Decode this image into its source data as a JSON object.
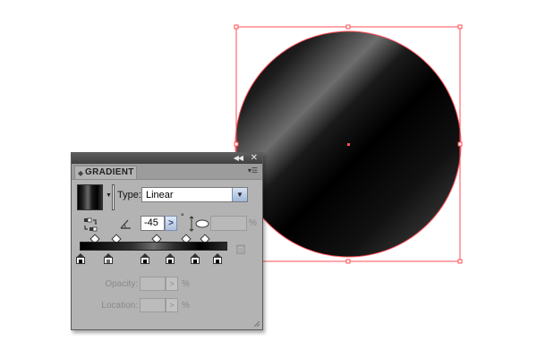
{
  "artwork": {
    "shape": "circle",
    "fill": "black linear gradient with diagonal highlight",
    "selection_color": "#ff4d55"
  },
  "panel": {
    "title": "GRADIENT",
    "controls": {
      "collapse_icon": "double-left-arrow",
      "close_icon": "close",
      "menu_icon": "panel-menu"
    },
    "type_label": "Type:",
    "type_value": "Linear",
    "angle_value": "-45",
    "angle_arrow": ">",
    "degree_symbol": "°",
    "aspect_unit": "%",
    "gradient_stops": 6,
    "midpoints": 5,
    "opacity_label": "Opacity:",
    "opacity_unit": "%",
    "location_label": "Location:",
    "location_unit": "%",
    "disabled_arrow": ">"
  },
  "colors": {
    "panel_bg": "#b3b3b3",
    "titlebar": "#4a4a4a",
    "accent_blue": "#9fb6d8",
    "selection": "#ff4d55"
  }
}
